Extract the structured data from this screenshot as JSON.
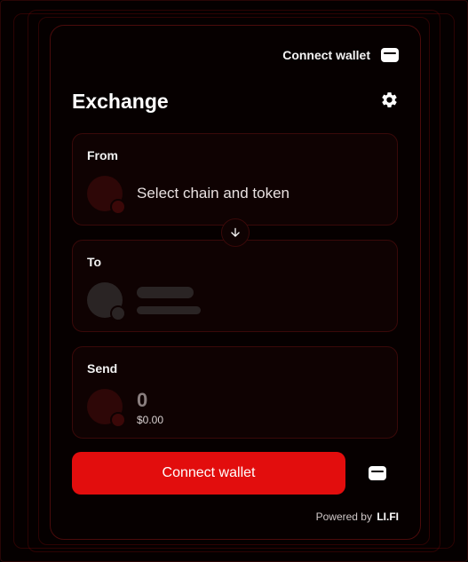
{
  "header": {
    "connect_wallet_label": "Connect wallet",
    "title": "Exchange"
  },
  "from": {
    "label": "From",
    "placeholder": "Select chain and token"
  },
  "to": {
    "label": "To"
  },
  "send": {
    "label": "Send",
    "amount": "0",
    "usd_value": "$0.00"
  },
  "actions": {
    "connect_wallet_label": "Connect wallet"
  },
  "footer": {
    "powered_by": "Powered by",
    "brand": "LI.FI"
  },
  "colors": {
    "accent": "#e20d0d",
    "background": "#060000",
    "card": "#0f0202",
    "border": "#3a0909"
  },
  "icons": [
    "wallet-icon",
    "gear-icon",
    "arrow-down-icon"
  ]
}
